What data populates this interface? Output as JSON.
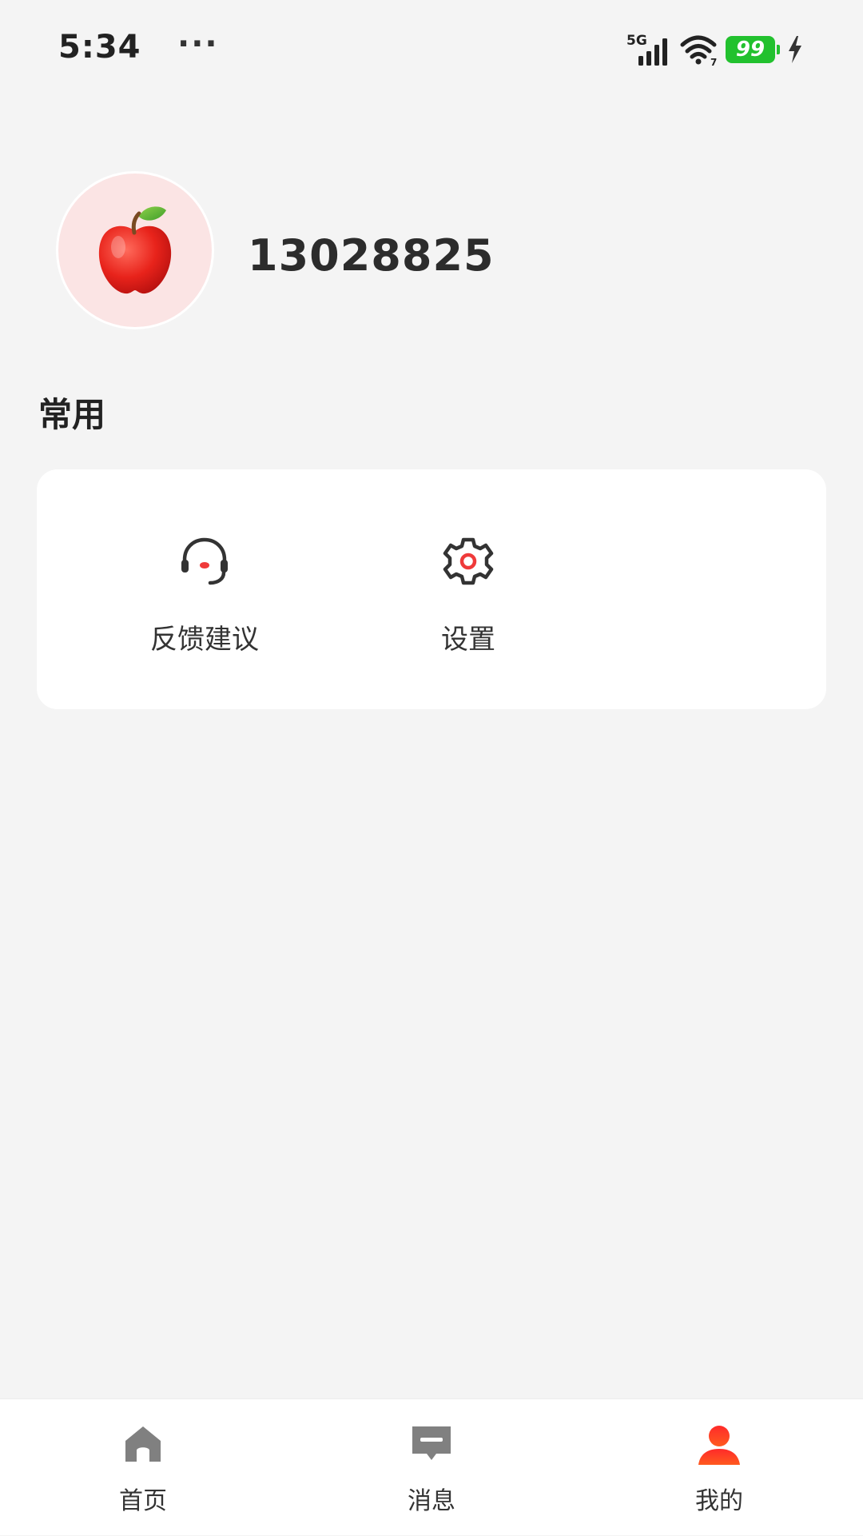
{
  "status_bar": {
    "time": "5:34",
    "more": "···",
    "network": "5G",
    "wifi_badge": "7",
    "battery": "99"
  },
  "profile": {
    "id": "13028825",
    "avatar_icon": "apple-icon"
  },
  "section": {
    "title": "常用"
  },
  "common_items": [
    {
      "label": "反馈建议",
      "icon": "headset-icon"
    },
    {
      "label": "设置",
      "icon": "gear-icon"
    }
  ],
  "bottom_nav": {
    "active_color": "#ff3b2f",
    "inactive_color": "#808080",
    "items": [
      {
        "label": "首页",
        "icon": "home-icon"
      },
      {
        "label": "消息",
        "icon": "message-icon"
      },
      {
        "label": "我的",
        "icon": "user-icon",
        "active": true
      }
    ]
  }
}
